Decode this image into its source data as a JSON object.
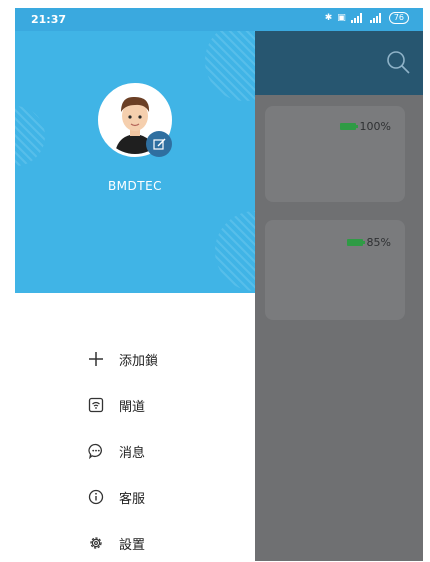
{
  "status_bar": {
    "time": "21:37",
    "battery": "76"
  },
  "background_app": {
    "cards": [
      {
        "battery_label": "100%"
      },
      {
        "battery_label": "85%"
      }
    ]
  },
  "drawer": {
    "username": "BMDTEC",
    "menu": [
      {
        "label": "添加鎖",
        "icon": "plus-icon"
      },
      {
        "label": "閘道",
        "icon": "gateway-icon"
      },
      {
        "label": "消息",
        "icon": "message-icon"
      },
      {
        "label": "客服",
        "icon": "info-icon"
      },
      {
        "label": "設置",
        "icon": "gear-icon"
      }
    ]
  },
  "colors": {
    "header": "#40b4e6",
    "toolbar": "#275670",
    "battery_green": "#2f9b45"
  }
}
